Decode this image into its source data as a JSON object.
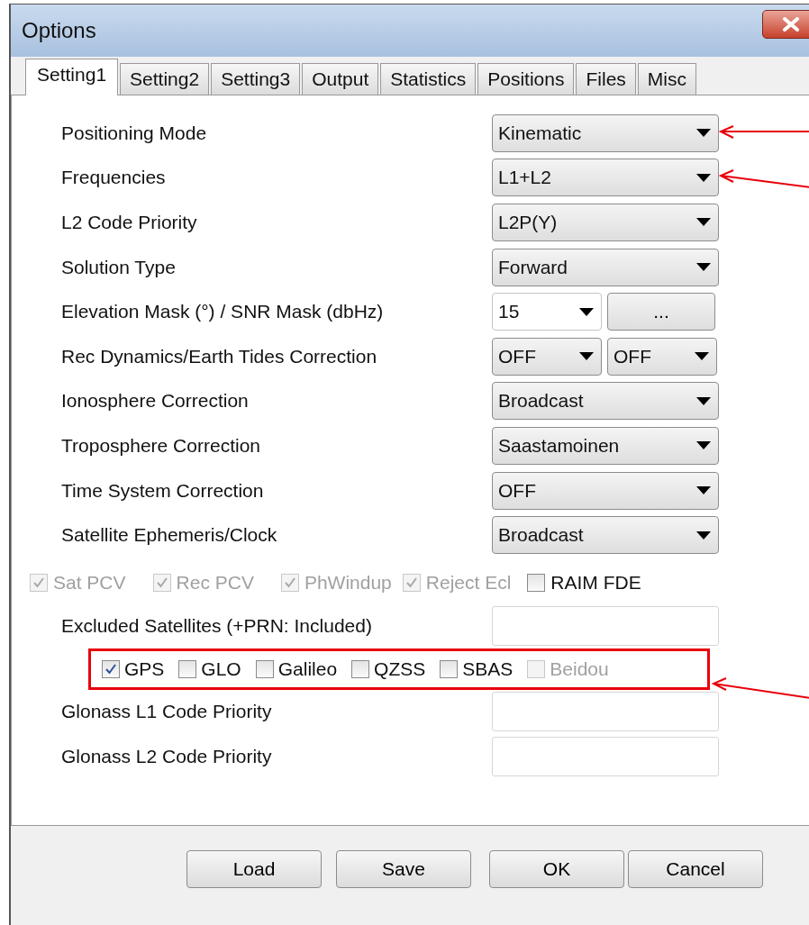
{
  "window": {
    "title": "Options"
  },
  "tabs": [
    {
      "label": "Setting1",
      "selected": true
    },
    {
      "label": "Setting2",
      "selected": false
    },
    {
      "label": "Setting3",
      "selected": false
    },
    {
      "label": "Output",
      "selected": false
    },
    {
      "label": "Statistics",
      "selected": false
    },
    {
      "label": "Positions",
      "selected": false
    },
    {
      "label": "Files",
      "selected": false
    },
    {
      "label": "Misc",
      "selected": false
    }
  ],
  "rows": [
    {
      "label": "Positioning Mode",
      "arrowed": true,
      "controls": [
        {
          "kind": "combo",
          "value": "Kinematic"
        }
      ]
    },
    {
      "label": "Frequencies",
      "arrowed": true,
      "controls": [
        {
          "kind": "combo",
          "value": "L1+L2"
        }
      ]
    },
    {
      "label": "L2 Code Priority",
      "controls": [
        {
          "kind": "combo",
          "value": "L2P(Y)"
        }
      ]
    },
    {
      "label": "Solution Type",
      "controls": [
        {
          "kind": "combo",
          "value": "Forward"
        }
      ]
    },
    {
      "label": "Elevation Mask (°) / SNR Mask (dbHz)",
      "controls": [
        {
          "kind": "edit_combo",
          "value": "15"
        },
        {
          "kind": "button",
          "label": "..."
        }
      ]
    },
    {
      "label": "Rec Dynamics/Earth Tides Correction",
      "controls": [
        {
          "kind": "combo",
          "value": "OFF"
        },
        {
          "kind": "combo",
          "value": "OFF"
        }
      ]
    },
    {
      "label": "Ionosphere Correction",
      "controls": [
        {
          "kind": "combo",
          "value": "Broadcast"
        }
      ]
    },
    {
      "label": "Troposphere Correction",
      "controls": [
        {
          "kind": "combo",
          "value": "Saastamoinen"
        }
      ]
    },
    {
      "label": "Time System Correction",
      "controls": [
        {
          "kind": "combo",
          "value": "OFF"
        }
      ]
    },
    {
      "label": "Satellite Ephemeris/Clock",
      "controls": [
        {
          "kind": "combo",
          "value": "Broadcast"
        }
      ]
    }
  ],
  "options": [
    {
      "label": "Sat PCV",
      "checked": true,
      "disabled": true
    },
    {
      "label": "Rec PCV",
      "checked": true,
      "disabled": true
    },
    {
      "label": "PhWindup",
      "checked": true,
      "disabled": true
    },
    {
      "label": "Reject Ecl",
      "checked": true,
      "disabled": true
    },
    {
      "label": "RAIM FDE",
      "checked": false,
      "disabled": false
    }
  ],
  "excluded": {
    "label": "Excluded Satellites (+PRN: Included)"
  },
  "systems": {
    "highlighted": true,
    "arrowed": true,
    "items": [
      {
        "label": "GPS",
        "checked": true,
        "disabled": false
      },
      {
        "label": "GLO",
        "checked": false,
        "disabled": false
      },
      {
        "label": "Galileo",
        "checked": false,
        "disabled": false
      },
      {
        "label": "QZSS",
        "checked": false,
        "disabled": false
      },
      {
        "label": "SBAS",
        "checked": false,
        "disabled": false
      },
      {
        "label": "Beidou",
        "checked": false,
        "disabled": true
      }
    ]
  },
  "code_rows": [
    {
      "label": "Glonass L1 Code Priority"
    },
    {
      "label": "Glonass L2 Code Priority"
    }
  ],
  "buttons": [
    {
      "label": "Load"
    },
    {
      "label": "Save"
    },
    {
      "label": "OK"
    },
    {
      "label": "Cancel"
    }
  ]
}
